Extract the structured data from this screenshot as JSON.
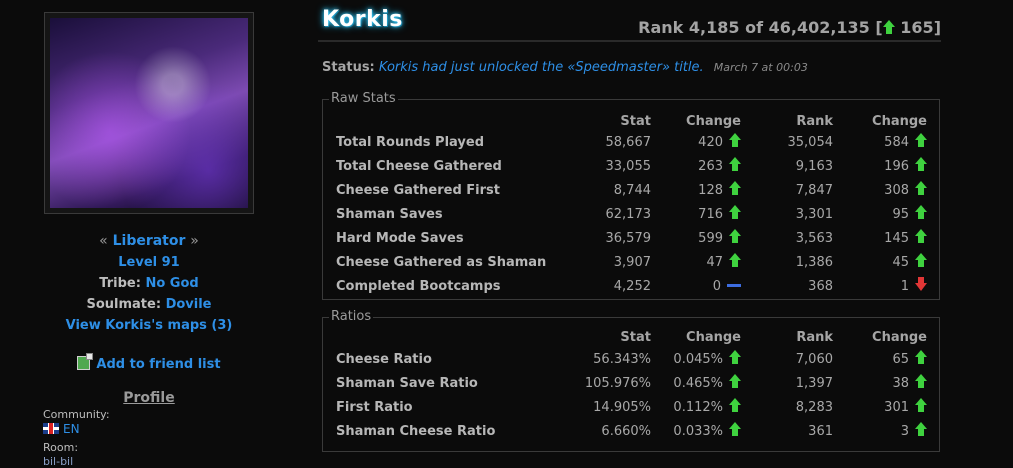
{
  "profile": {
    "title": "Liberator",
    "level": "Level 91",
    "tribe_label": "Tribe:",
    "tribe": "No God",
    "soulmate_label": "Soulmate:",
    "soulmate": "Dovile",
    "maps_link": "View Korkis's maps (3)",
    "add_friend": "Add to friend list",
    "section_heading": "Profile",
    "community_label": "Community:",
    "community": "EN",
    "room_label": "Room:",
    "room_value": "bil-bil"
  },
  "header": {
    "player_name": "Korkis",
    "rank_prefix": "Rank 4,185 of 46,402,135 [",
    "rank_change": "165",
    "rank_suffix": "]"
  },
  "status": {
    "label": "Status:",
    "text": "Korkis had just unlocked the «Speedmaster» title.",
    "time": "March 7 at 00:03"
  },
  "columns": {
    "stat": "Stat",
    "change": "Change",
    "rank": "Rank",
    "rank_change": "Change"
  },
  "raw_stats": {
    "legend": "Raw Stats",
    "rows": [
      {
        "name": "Total Rounds Played",
        "stat": "58,667",
        "change": "420",
        "change_dir": "up",
        "rank": "35,054",
        "rank_change": "584",
        "rank_dir": "up"
      },
      {
        "name": "Total Cheese Gathered",
        "stat": "33,055",
        "change": "263",
        "change_dir": "up",
        "rank": "9,163",
        "rank_change": "196",
        "rank_dir": "up"
      },
      {
        "name": "Cheese Gathered First",
        "stat": "8,744",
        "change": "128",
        "change_dir": "up",
        "rank": "7,847",
        "rank_change": "308",
        "rank_dir": "up"
      },
      {
        "name": "Shaman Saves",
        "stat": "62,173",
        "change": "716",
        "change_dir": "up",
        "rank": "3,301",
        "rank_change": "95",
        "rank_dir": "up"
      },
      {
        "name": "Hard Mode Saves",
        "stat": "36,579",
        "change": "599",
        "change_dir": "up",
        "rank": "3,563",
        "rank_change": "145",
        "rank_dir": "up"
      },
      {
        "name": "Cheese Gathered as Shaman",
        "stat": "3,907",
        "change": "47",
        "change_dir": "up",
        "rank": "1,386",
        "rank_change": "45",
        "rank_dir": "up"
      },
      {
        "name": "Completed Bootcamps",
        "stat": "4,252",
        "change": "0",
        "change_dir": "none",
        "rank": "368",
        "rank_change": "1",
        "rank_dir": "down"
      }
    ]
  },
  "ratios": {
    "legend": "Ratios",
    "rows": [
      {
        "name": "Cheese Ratio",
        "stat": "56.343%",
        "change": "0.045%",
        "change_dir": "up",
        "rank": "7,060",
        "rank_change": "65",
        "rank_dir": "up"
      },
      {
        "name": "Shaman Save Ratio",
        "stat": "105.976%",
        "change": "0.465%",
        "change_dir": "up",
        "rank": "1,397",
        "rank_change": "38",
        "rank_dir": "up"
      },
      {
        "name": "First Ratio",
        "stat": "14.905%",
        "change": "0.112%",
        "change_dir": "up",
        "rank": "8,283",
        "rank_change": "301",
        "rank_dir": "up"
      },
      {
        "name": "Shaman Cheese Ratio",
        "stat": "6.660%",
        "change": "0.033%",
        "change_dir": "up",
        "rank": "361",
        "rank_change": "3",
        "rank_dir": "up"
      }
    ]
  },
  "icons": {
    "up": "up-arrow-icon",
    "down": "down-arrow-icon",
    "none": "no-change-icon"
  },
  "colors": {
    "link": "#2e8fe6",
    "up": "#3fd23f",
    "down": "#e23636",
    "neutral": "#3d6de0"
  }
}
